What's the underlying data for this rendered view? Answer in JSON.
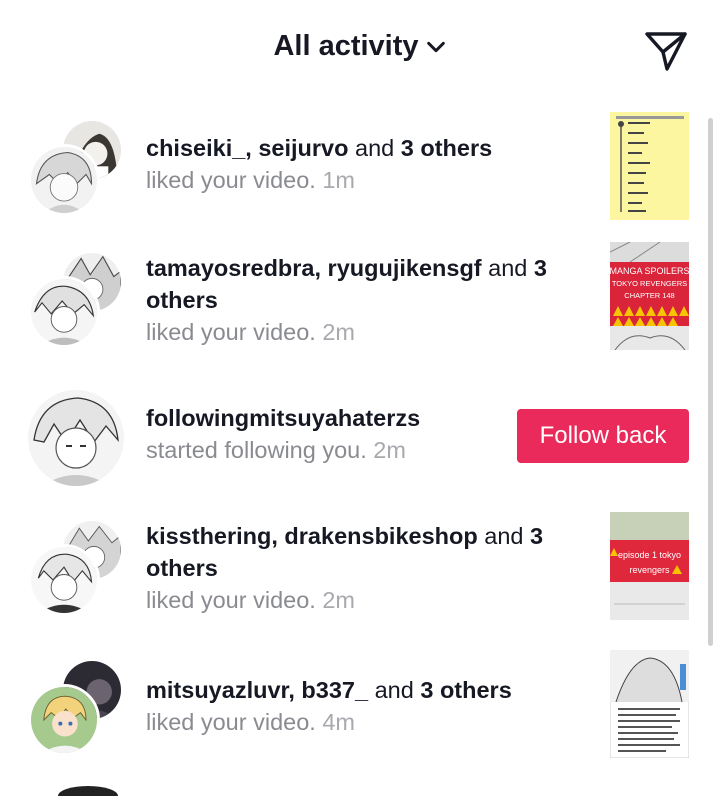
{
  "header": {
    "title": "All activity",
    "title_dropdown_icon": "chevron-down-icon",
    "action_icon": "send-direct-message-icon"
  },
  "colors": {
    "accent": "#ea2a5a",
    "primary_text": "#161823",
    "secondary_text": "#8a8b91"
  },
  "notifications": [
    {
      "users": "chiseiki_, seijurvo",
      "connector": " and ",
      "others": "3 others",
      "action": "liked your video.",
      "time": "1m"
    },
    {
      "users": "tamayosredbra, ryugujikensgf",
      "connector": " and ",
      "others": "3 others",
      "action": "liked your video.",
      "time": "2m",
      "thumb_lines": [
        "MANGA SPOILERS",
        "TOKYO REVENGERS",
        "CHAPTER 148"
      ]
    },
    {
      "users": "followingmitsuyahaterzs",
      "action": "started following you.",
      "time": "2m",
      "button": "Follow back"
    },
    {
      "users": "kissthering, drakensbikeshop",
      "connector": " and ",
      "others": "3 others",
      "action": "liked your video.",
      "time": "2m",
      "thumb_lines": [
        "episode 1 tokyo",
        "revengers"
      ]
    },
    {
      "users": "mitsuyazluvr, b337_",
      "connector": " and ",
      "others": "3 others",
      "action": "liked your video.",
      "time": "4m"
    }
  ]
}
